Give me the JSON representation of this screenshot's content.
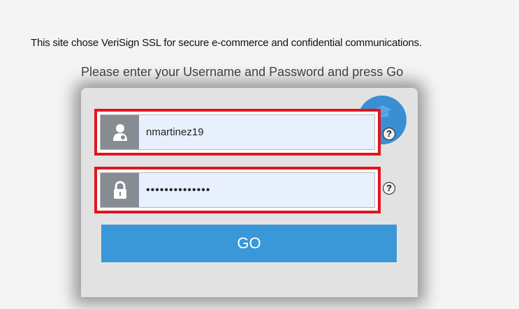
{
  "notice": "This site chose VeriSign SSL for secure e-commerce and confidential communications.",
  "prompt": "Please enter your Username and Password and press Go",
  "username": {
    "value": "nmartinez19",
    "icon": "user-icon"
  },
  "password": {
    "value": "••••••••••••••",
    "icon": "lock-icon"
  },
  "help_label": "?",
  "go_label": "GO",
  "colors": {
    "accent": "#3a97d8",
    "highlight": "#e0151e",
    "field_bg": "#e8f0fe",
    "icon_bg": "#878b92"
  }
}
